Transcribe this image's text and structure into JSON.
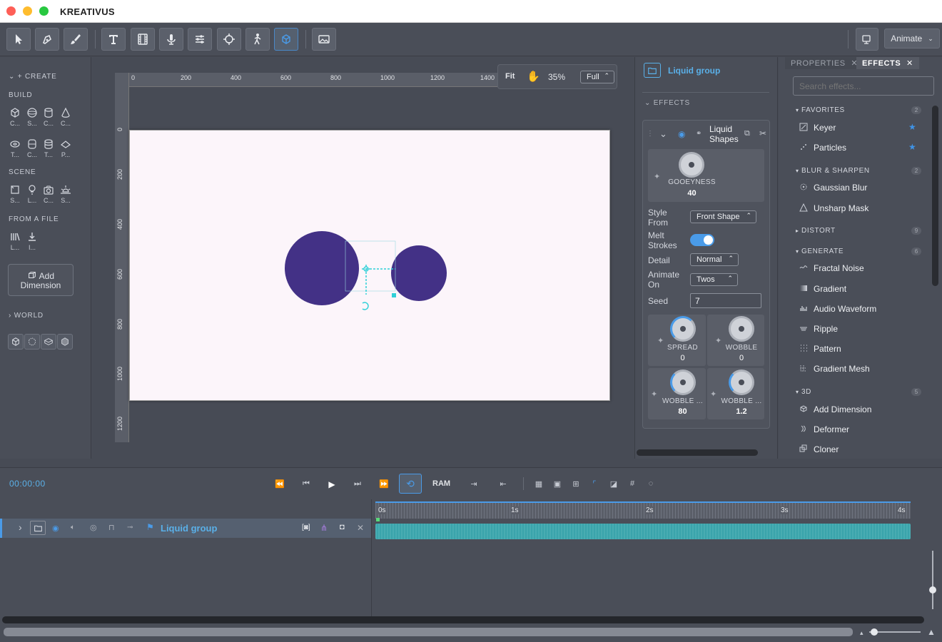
{
  "app": {
    "title": "KREATIVUS"
  },
  "toolbar": {
    "animate_label": "Animate"
  },
  "left_panel": {
    "create_label": "CREATE",
    "build_label": "BUILD",
    "build_items": [
      "C...",
      "S...",
      "C...",
      "C...",
      "T...",
      "C...",
      "T...",
      "P..."
    ],
    "scene_label": "SCENE",
    "scene_items": [
      "S...",
      "L...",
      "C...",
      "S..."
    ],
    "from_file_label": "FROM A FILE",
    "file_items": [
      "L...",
      "I..."
    ],
    "add_dimension_label": "Add\nDimension",
    "world_label": "WORLD"
  },
  "canvas": {
    "ruler_top": [
      "0",
      "200",
      "400",
      "600",
      "800",
      "1000",
      "1200",
      "1400"
    ],
    "ruler_left": [
      "0",
      "200",
      "400",
      "600",
      "800",
      "1000",
      "1200"
    ],
    "zoom_fit": "Fit",
    "zoom_percent": "35%",
    "zoom_quality": "Full"
  },
  "effect_panel": {
    "group_name": "Liquid group",
    "effects_label": "EFFECTS",
    "effect_title": "Liquid Shapes",
    "gooeyness_label": "GOOEYNESS",
    "gooeyness_value": "40",
    "style_from_label": "Style From",
    "style_from_value": "Front Shape",
    "melt_strokes_label": "Melt Strokes",
    "melt_strokes_on": true,
    "detail_label": "Detail",
    "detail_value": "Normal",
    "animate_on_label": "Animate On",
    "animate_on_value": "Twos",
    "seed_label": "Seed",
    "seed_value": "7",
    "spread_label": "SPREAD",
    "spread_value": "0",
    "wobble_label": "WOBBLE",
    "wobble_value": "0",
    "wobble2_label": "WOBBLE ...",
    "wobble2_value": "80",
    "wobble3_label": "WOBBLE ...",
    "wobble3_value": "1.2"
  },
  "effects_list": {
    "tab_properties": "PROPERTIES",
    "tab_effects": "EFFECTS",
    "search_placeholder": "Search effects...",
    "favorites_label": "FAVORITES",
    "favorites_count": "2",
    "keyer": "Keyer",
    "particles": "Particles",
    "blur_label": "BLUR & SHARPEN",
    "blur_count": "2",
    "gaussian_blur": "Gaussian Blur",
    "unsharp_mask": "Unsharp Mask",
    "distort_label": "DISTORT",
    "distort_count": "9",
    "generate_label": "GENERATE",
    "generate_count": "6",
    "fractal_noise": "Fractal Noise",
    "gradient": "Gradient",
    "audio_waveform": "Audio Waveform",
    "ripple": "Ripple",
    "pattern": "Pattern",
    "gradient_mesh": "Gradient Mesh",
    "three_d_label": "3D",
    "three_d_count": "5",
    "add_dimension": "Add Dimension",
    "deformer": "Deformer",
    "cloner": "Cloner"
  },
  "timeline": {
    "timecode": "00:00:00",
    "ram_label": "RAM",
    "layer_name": "Liquid group",
    "ticks": [
      "0s",
      "1s",
      "2s",
      "3s",
      "4s"
    ]
  },
  "colors": {
    "accent": "#3f93e6",
    "circle": "#433186",
    "track": "#3aa4ab",
    "handle": "#2fd0d8"
  }
}
